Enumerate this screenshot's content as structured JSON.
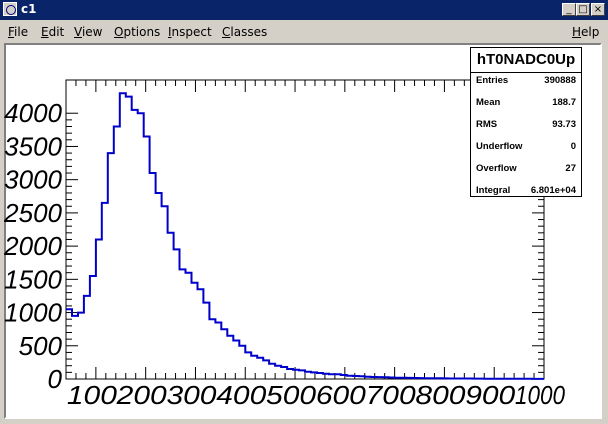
{
  "window": {
    "title": "c1",
    "min": "_",
    "max": "□",
    "close": "×"
  },
  "menu": {
    "items": [
      {
        "label": "File",
        "ul": "F",
        "rest": "ile"
      },
      {
        "label": "Edit",
        "ul": "E",
        "rest": "dit"
      },
      {
        "label": "View",
        "ul": "V",
        "rest": "iew"
      },
      {
        "label": "Options",
        "ul": "O",
        "rest": "ptions"
      },
      {
        "label": "Inspect",
        "ul": "I",
        "rest": "nspect"
      },
      {
        "label": "Classes",
        "ul": "C",
        "rest": "lasses"
      }
    ],
    "help": {
      "label": "Help",
      "ul": "H",
      "rest": "elp"
    }
  },
  "stats": {
    "title": "hT0NADC0Up",
    "rows": [
      {
        "label": "Entries",
        "value": "390888"
      },
      {
        "label": "Mean",
        "value": "188.7"
      },
      {
        "label": "RMS",
        "value": "93.73"
      },
      {
        "label": "Underflow",
        "value": "0"
      },
      {
        "label": "Overflow",
        "value": "27"
      },
      {
        "label": "Integral",
        "value": "6.801e+04"
      }
    ]
  },
  "colors": {
    "line": "#0000cc",
    "titlebar": "#0a246a",
    "chrome": "#d4d0c8"
  },
  "chart_data": {
    "type": "histogram",
    "xlim": [
      40,
      1000
    ],
    "ylim": [
      0,
      4500
    ],
    "xticks": [
      100,
      200,
      300,
      400,
      500,
      600,
      700,
      800,
      900,
      1000
    ],
    "yticks": [
      0,
      500,
      1000,
      1500,
      2000,
      2500,
      3000,
      3500,
      4000
    ],
    "bin_width": 12,
    "bin_start": 40,
    "values": [
      1050,
      950,
      1000,
      1250,
      1550,
      2100,
      2650,
      3400,
      3800,
      4300,
      4250,
      4050,
      4000,
      3650,
      3100,
      2800,
      2600,
      2200,
      1950,
      1650,
      1600,
      1450,
      1350,
      1150,
      900,
      850,
      750,
      650,
      580,
      500,
      400,
      350,
      320,
      280,
      230,
      200,
      180,
      150,
      140,
      130,
      110,
      100,
      90,
      80,
      70,
      70,
      60,
      50,
      45,
      40,
      35,
      30,
      28,
      25,
      22,
      20,
      18,
      16,
      15,
      14,
      12,
      11,
      10,
      9,
      8,
      8,
      7,
      7,
      6,
      6,
      5,
      5,
      4,
      4,
      4,
      3,
      3,
      3,
      2,
      2
    ]
  }
}
